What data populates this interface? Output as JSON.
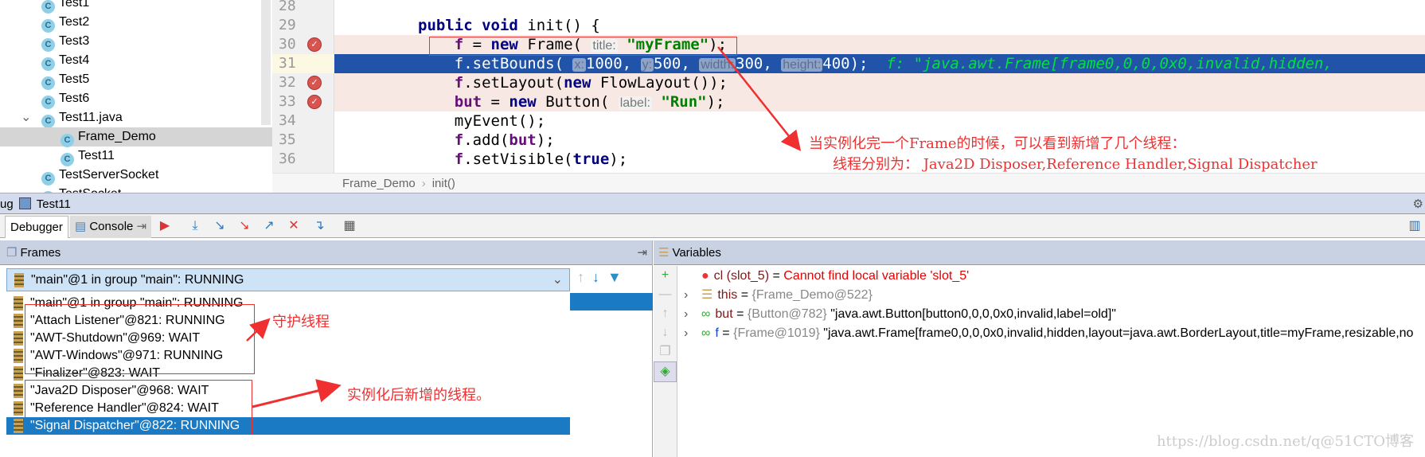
{
  "project_tree": {
    "items": [
      {
        "label": "Test1",
        "indent": 1
      },
      {
        "label": "Test2",
        "indent": 1
      },
      {
        "label": "Test3",
        "indent": 1
      },
      {
        "label": "Test4",
        "indent": 1
      },
      {
        "label": "Test5",
        "indent": 1
      },
      {
        "label": "Test6",
        "indent": 1
      },
      {
        "label": "Test11.java",
        "indent": 1,
        "expanded": true
      },
      {
        "label": "Frame_Demo",
        "indent": 2,
        "selected": true
      },
      {
        "label": "Test11",
        "indent": 2
      },
      {
        "label": "TestServerSocket",
        "indent": 1
      },
      {
        "label": "TestSocket",
        "indent": 1
      }
    ]
  },
  "editor": {
    "line_numbers": [
      "28",
      "29",
      "30",
      "31",
      "32",
      "33",
      "34",
      "35",
      "36"
    ],
    "breakpoints": [
      "30",
      "32",
      "33"
    ],
    "current_line": "31",
    "lines": [
      [],
      [
        {
          "t": "public",
          "c": "kw"
        },
        {
          "t": " "
        },
        {
          "t": "void",
          "c": "kw"
        },
        {
          "t": " init() {"
        }
      ],
      [
        {
          "t": "    "
        },
        {
          "t": "f",
          "c": "fld"
        },
        {
          "t": " = "
        },
        {
          "t": "new",
          "c": "kw"
        },
        {
          "t": " Frame( "
        },
        {
          "t": "title:",
          "c": "hint"
        },
        {
          "t": " "
        },
        {
          "t": "\"myFrame\"",
          "c": "str"
        },
        {
          "t": ");"
        }
      ],
      [
        {
          "t": "    f.setBounds( "
        },
        {
          "t": "x:",
          "c": "hint"
        },
        {
          "t": "1000, "
        },
        {
          "t": "y:",
          "c": "hint"
        },
        {
          "t": "500, "
        },
        {
          "t": "width:",
          "c": "hint"
        },
        {
          "t": "300, "
        },
        {
          "t": "height:",
          "c": "hint"
        },
        {
          "t": "400);  "
        },
        {
          "t": "f: \"java.awt.Frame[frame0,0,0,0x0,invalid,hidden,",
          "c": "inl"
        }
      ],
      [
        {
          "t": "    "
        },
        {
          "t": "f",
          "c": "fld"
        },
        {
          "t": ".setLayout("
        },
        {
          "t": "new",
          "c": "kw"
        },
        {
          "t": " FlowLayout());"
        }
      ],
      [
        {
          "t": "    "
        },
        {
          "t": "but",
          "c": "fld"
        },
        {
          "t": " = "
        },
        {
          "t": "new",
          "c": "kw"
        },
        {
          "t": " Button( "
        },
        {
          "t": "label:",
          "c": "hint"
        },
        {
          "t": " "
        },
        {
          "t": "\"Run\"",
          "c": "str"
        },
        {
          "t": ");"
        }
      ],
      [
        {
          "t": "    myEvent();"
        }
      ],
      [
        {
          "t": "    "
        },
        {
          "t": "f",
          "c": "fld"
        },
        {
          "t": ".add("
        },
        {
          "t": "but",
          "c": "fld"
        },
        {
          "t": ");"
        }
      ],
      [
        {
          "t": "    "
        },
        {
          "t": "f",
          "c": "fld"
        },
        {
          "t": ".setVisible("
        },
        {
          "t": "true",
          "c": "kw"
        },
        {
          "t": ");"
        }
      ]
    ],
    "breadcrumb": [
      "Frame_Demo",
      "init()"
    ]
  },
  "debug": {
    "title_prefix": "ug",
    "run_config": "Test11",
    "tabs": [
      "Debugger",
      "Console"
    ]
  },
  "frames": {
    "title": "Frames",
    "selected_thread": "\"main\"@1 in group \"main\": RUNNING",
    "threads": [
      "\"main\"@1 in group \"main\": RUNNING",
      "\"Attach Listener\"@821: RUNNING",
      "\"AWT-Shutdown\"@969: WAIT",
      "\"AWT-Windows\"@971: RUNNING",
      "\"Finalizer\"@823: WAIT",
      "\"Java2D Disposer\"@968: WAIT",
      "\"Reference Handler\"@824: WAIT",
      "\"Signal Dispatcher\"@822: RUNNING"
    ],
    "highlighted_thread_index": 7
  },
  "variables": {
    "title": "Variables",
    "items": [
      {
        "name": "cl (slot_5)",
        "eq": " = ",
        "ref": "",
        "value": "Cannot find local variable 'slot_5'",
        "icon": "error-icon"
      },
      {
        "name": "this",
        "eq": " = ",
        "ref": "{Frame_Demo@522}",
        "value": "",
        "icon": "object-icon"
      },
      {
        "name": "but",
        "eq": " = ",
        "ref": "{Button@782}",
        "value": " \"java.awt.Button[button0,0,0,0x0,invalid,label=old]\"",
        "icon": "watch-icon"
      },
      {
        "name": "f",
        "eq": " = ",
        "ref": "{Frame@1019}",
        "value": " \"java.awt.Frame[frame0,0,0,0x0,invalid,hidden,layout=java.awt.BorderLayout,title=myFrame,resizable,no",
        "icon": "watch-icon"
      }
    ]
  },
  "annotations": {
    "note1_line1": "当实例化完一个Frame的时候，可以看到新增了几个线程：",
    "note1_line2": "线程分别为：   Java2D Disposer,Reference Handler,Signal Dispatcher",
    "daemon_label": "守护线程",
    "new_threads_label": "实例化后新增的线程。",
    "color": "#f03030"
  },
  "watermark": "https://blog.csdn.net/q@51CTO博客"
}
